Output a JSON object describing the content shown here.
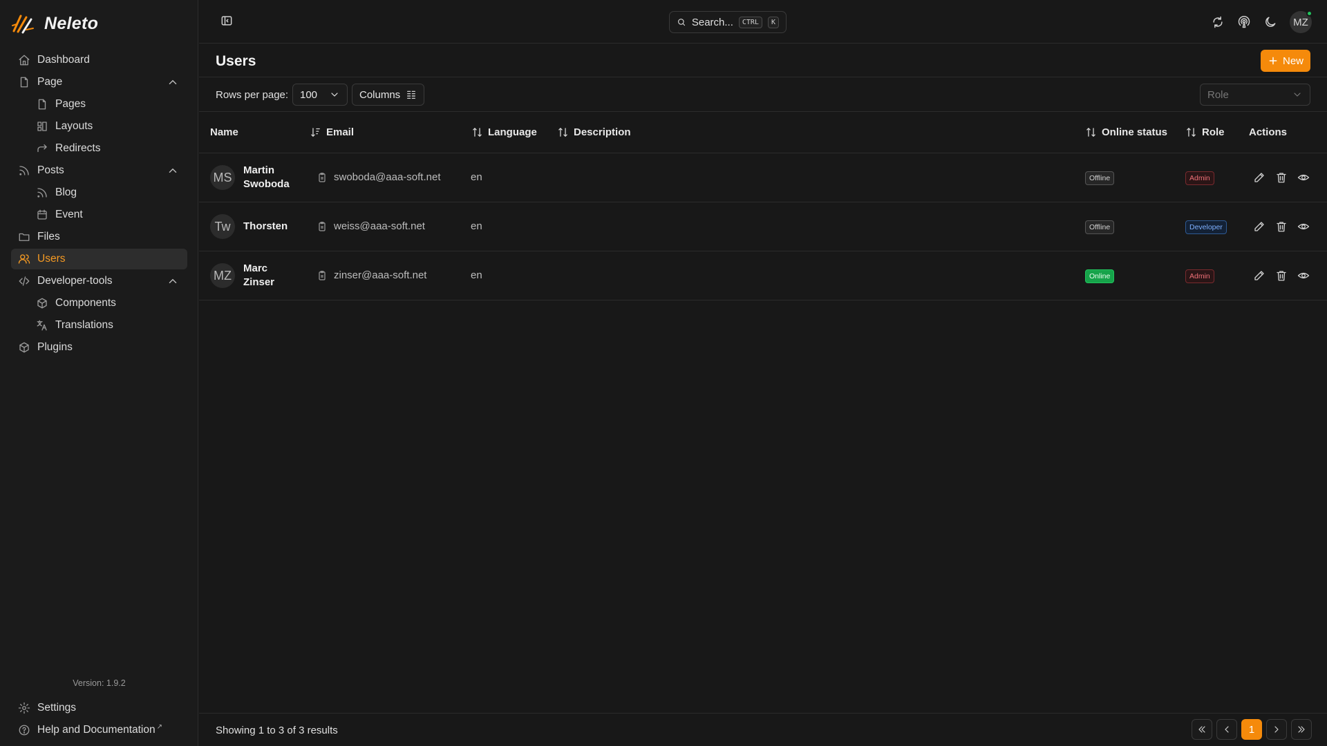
{
  "app": {
    "name": "Neleto",
    "version": "Version: 1.9.2"
  },
  "colors": {
    "accent": "#f58a0b",
    "online": "#22c55e",
    "admin": "#f07178",
    "developer": "#7fb0ff"
  },
  "sidebar": {
    "items": [
      {
        "label": "Dashboard",
        "icon": "home-icon"
      },
      {
        "label": "Page",
        "icon": "file-icon",
        "expanded": true
      },
      {
        "label": "Pages",
        "icon": "file-icon"
      },
      {
        "label": "Layouts",
        "icon": "layout-icon"
      },
      {
        "label": "Redirects",
        "icon": "redirect-icon"
      },
      {
        "label": "Posts",
        "icon": "rss-icon",
        "expanded": true
      },
      {
        "label": "Blog",
        "icon": "rss-icon"
      },
      {
        "label": "Event",
        "icon": "calendar-icon"
      },
      {
        "label": "Files",
        "icon": "folder-icon"
      },
      {
        "label": "Users",
        "icon": "users-icon",
        "active": true
      },
      {
        "label": "Developer-tools",
        "icon": "code-icon",
        "expanded": true
      },
      {
        "label": "Components",
        "icon": "box-icon"
      },
      {
        "label": "Translations",
        "icon": "translate-icon"
      },
      {
        "label": "Plugins",
        "icon": "box-icon"
      }
    ],
    "footer": {
      "settings": "Settings",
      "help": "Help and Documentation",
      "external_mark": "↗"
    }
  },
  "topbar": {
    "search_label": "Search...",
    "kbd_ctrl": "CTRL",
    "kbd_k": "K",
    "avatar_initials": "MZ"
  },
  "page": {
    "title": "Users",
    "new_button": "New",
    "rows_per_page_label": "Rows per page:",
    "rows_per_page_value": "100",
    "columns_button": "Columns",
    "role_filter_placeholder": "Role"
  },
  "table": {
    "headers": {
      "name": "Name",
      "email": "Email",
      "language": "Language",
      "description": "Description",
      "online_status": "Online status",
      "role": "Role",
      "actions": "Actions"
    },
    "rows": [
      {
        "initials": "MS",
        "name": "Martin Swoboda",
        "email": "swoboda@aaa-soft.net",
        "language": "en",
        "description": "",
        "status": "Offline",
        "role": "Admin"
      },
      {
        "initials": "Tw",
        "name": "Thorsten",
        "email": "weiss@aaa-soft.net",
        "language": "en",
        "description": "",
        "status": "Offline",
        "role": "Developer"
      },
      {
        "initials": "MZ",
        "name": "Marc Zinser",
        "email": "zinser@aaa-soft.net",
        "language": "en",
        "description": "",
        "status": "Online",
        "role": "Admin"
      }
    ]
  },
  "footer": {
    "results_text": "Showing 1 to 3 of 3 results",
    "current_page": "1"
  }
}
